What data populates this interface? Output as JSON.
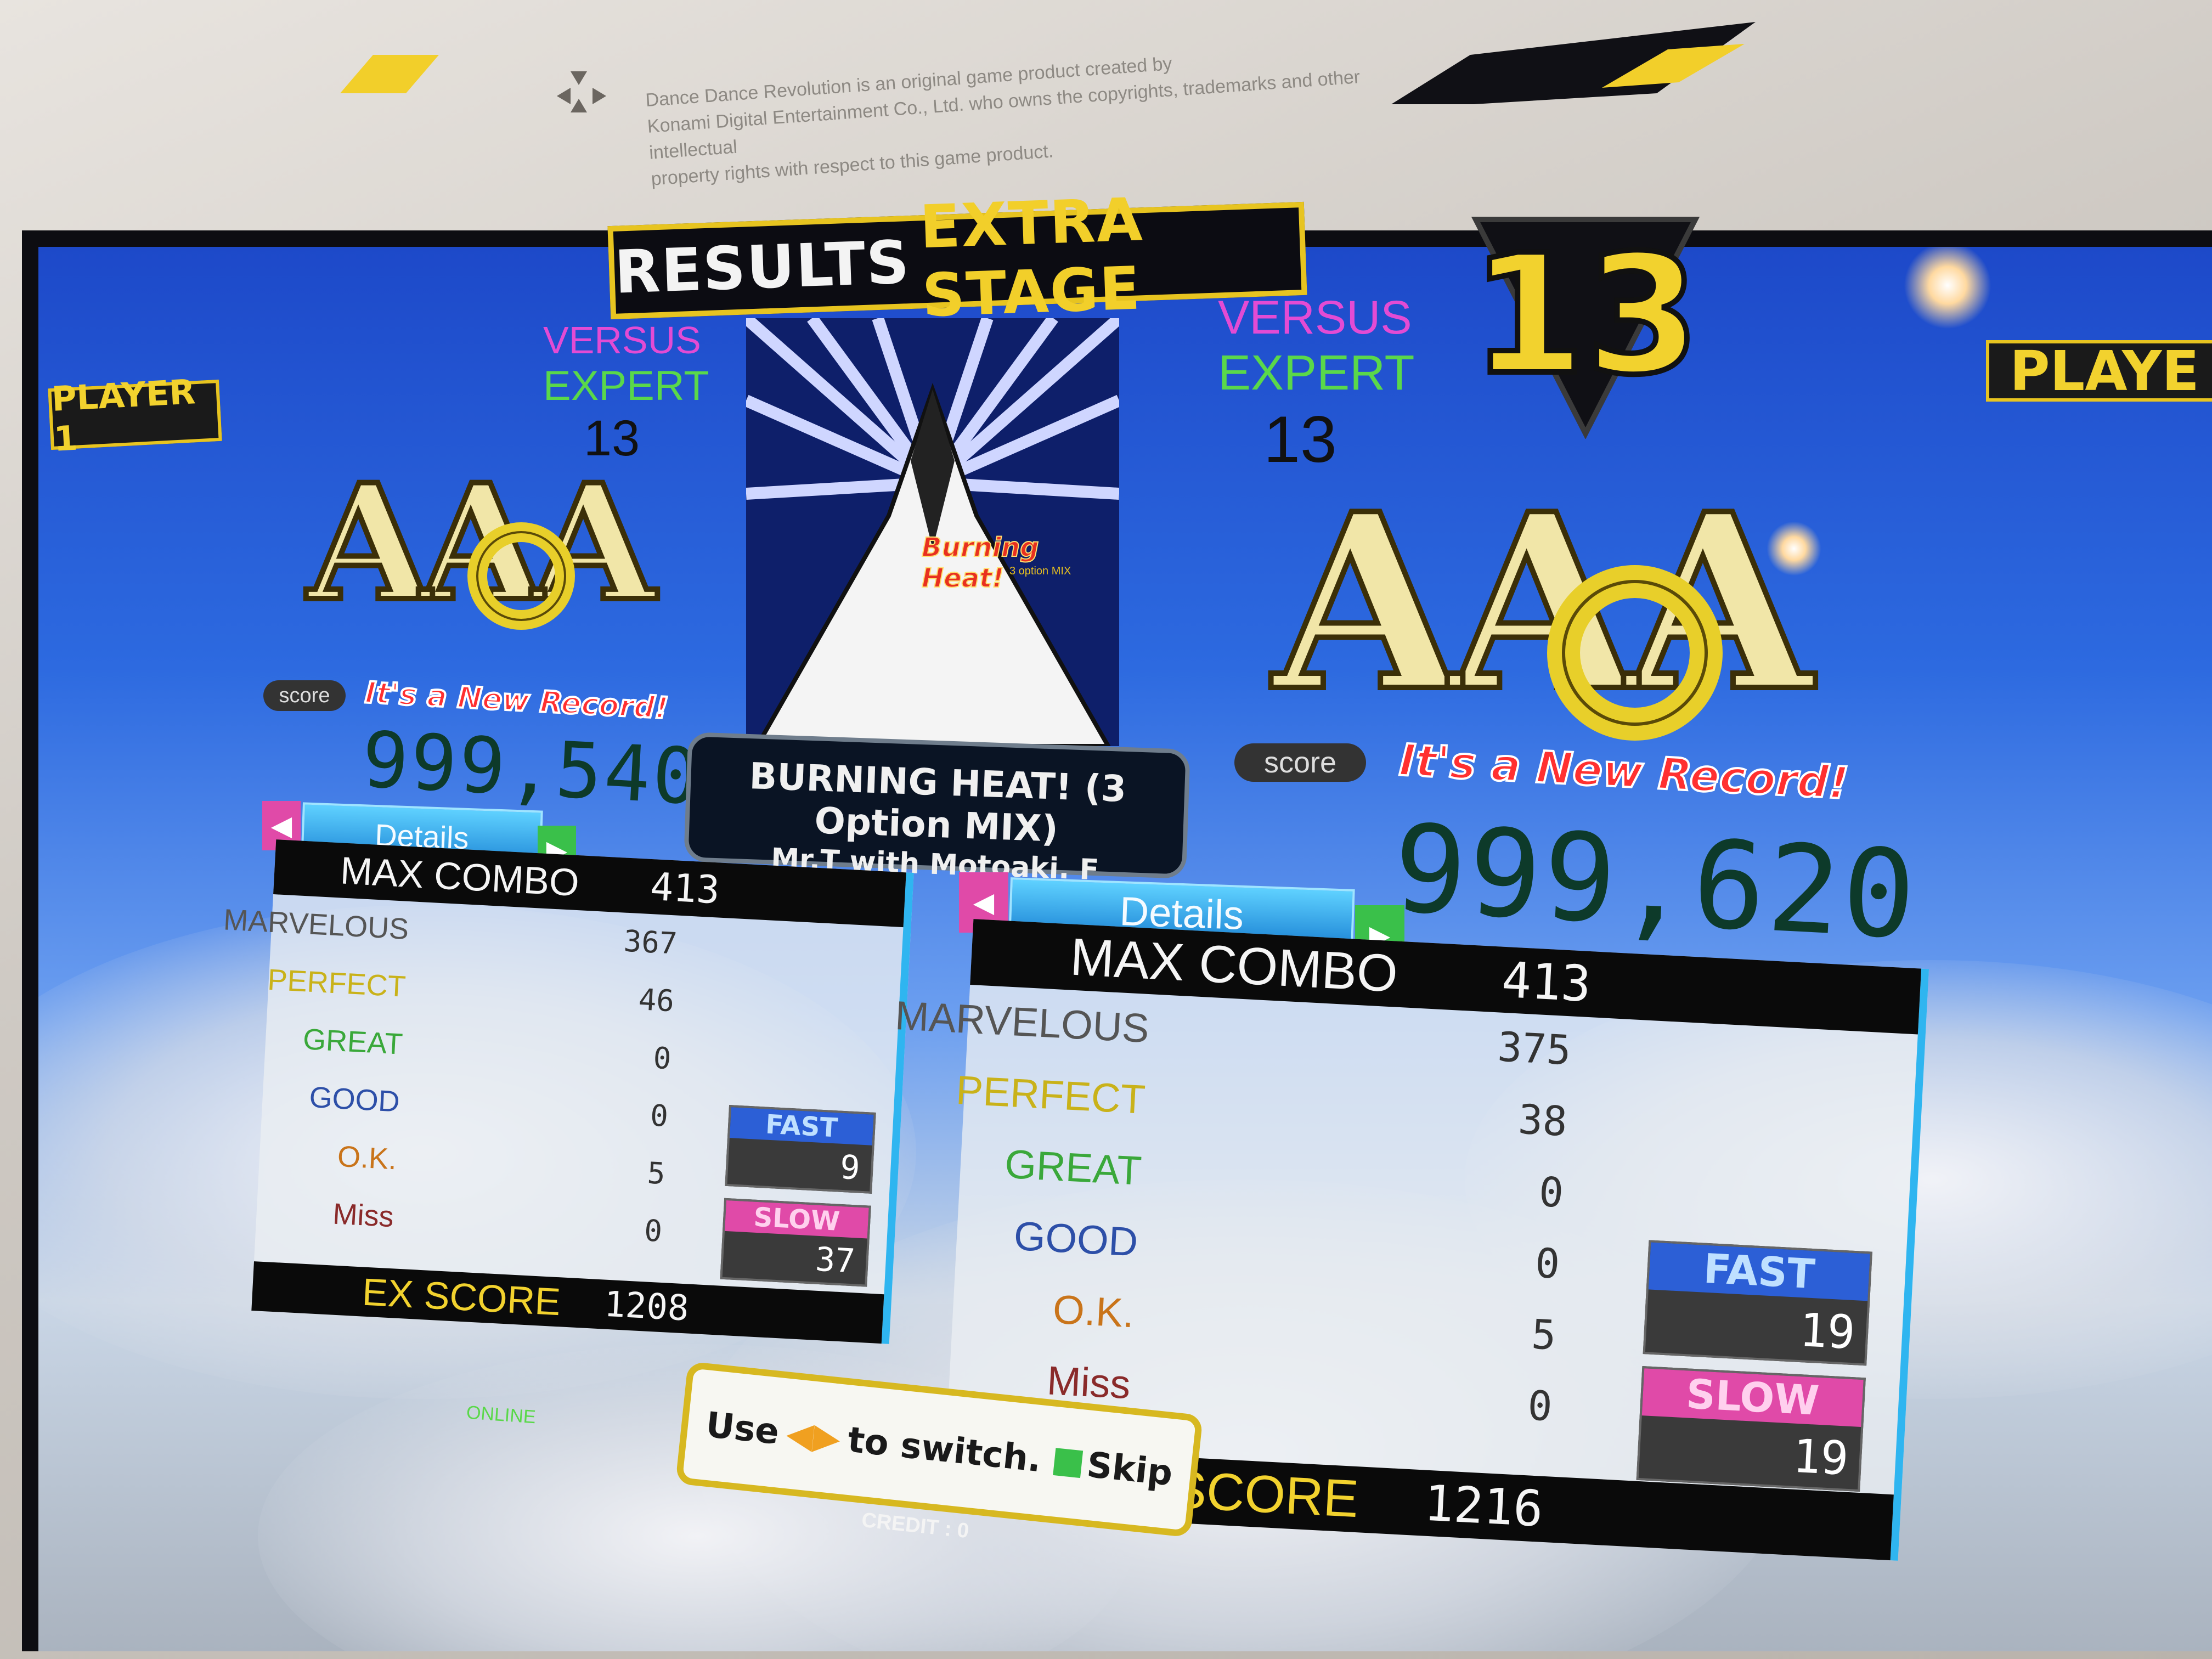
{
  "header": {
    "results_label": "RESULTS",
    "stage_label": "EXTRA STAGE",
    "stage_number": "13"
  },
  "players": {
    "p1_tag": "PLAYER 1",
    "p2_tag": "PLAYE"
  },
  "song": {
    "title": "BURNING HEAT! (3 Option MIX)",
    "artist": "Mr.T with Motoaki. F",
    "jacket_logo": "Burning Heat!",
    "jacket_sub": "3 option MIX"
  },
  "p1": {
    "mode": "VERSUS",
    "difficulty": "EXPERT",
    "level": "13",
    "grade": "AAA",
    "score_label": "score",
    "record_text": "It's a New Record!",
    "score": "999,540",
    "details_label": "Details",
    "max_combo_label": "MAX COMBO",
    "max_combo": "413",
    "judgements": [
      {
        "label": "MARVELOUS",
        "value": "367",
        "color": "#555555"
      },
      {
        "label": "PERFECT",
        "value": "46",
        "color": "#c9b21a"
      },
      {
        "label": "GREAT",
        "value": "0",
        "color": "#3aa83a"
      },
      {
        "label": "GOOD",
        "value": "0",
        "color": "#2d4fa8"
      },
      {
        "label": "O.K.",
        "value": "5",
        "color": "#c9741a"
      },
      {
        "label": "Miss",
        "value": "0",
        "color": "#8a2a2a"
      }
    ],
    "ex_score_label": "EX SCORE",
    "ex_score": "1208",
    "fast_label": "FAST",
    "fast": "9",
    "slow_label": "SLOW",
    "slow": "37"
  },
  "p2": {
    "mode": "VERSUS",
    "difficulty": "EXPERT",
    "level": "13",
    "grade": "AAA",
    "score_label": "score",
    "record_text": "It's a New Record!",
    "score": "999,620",
    "details_label": "Details",
    "max_combo_label": "MAX COMBO",
    "max_combo": "413",
    "judgements": [
      {
        "label": "MARVELOUS",
        "value": "375",
        "color": "#555555"
      },
      {
        "label": "PERFECT",
        "value": "38",
        "color": "#c9b21a"
      },
      {
        "label": "GREAT",
        "value": "0",
        "color": "#3aa83a"
      },
      {
        "label": "GOOD",
        "value": "0",
        "color": "#2d4fa8"
      },
      {
        "label": "O.K.",
        "value": "5",
        "color": "#c9741a"
      },
      {
        "label": "Miss",
        "value": "0",
        "color": "#8a2a2a"
      }
    ],
    "ex_score_label": "EX SCORE",
    "ex_score": "1216",
    "fast_label": "FAST",
    "fast": "19",
    "slow_label": "SLOW",
    "slow": "19"
  },
  "footer": {
    "hint_use": "Use",
    "hint_switch": "to switch.",
    "hint_skip": "Skip",
    "credit": "CREDIT : 0",
    "online": "ONLINE"
  },
  "bezel": {
    "notice_line1": "Dance Dance Revolution is an original game product created by",
    "notice_line2": "Konami Digital Entertainment Co., Ltd. who owns the copyrights, trademarks and other intellectual",
    "notice_line3": "property rights with respect to this game product."
  },
  "colors": {
    "accent_gold": "#e7c420",
    "versus": "#e34bd4",
    "expert": "#5ad84a",
    "record_red": "#ff3030",
    "panel_blue": "#2fb5f0",
    "fast_blue": "#2c5fd6",
    "slow_pink": "#e04aa8"
  }
}
